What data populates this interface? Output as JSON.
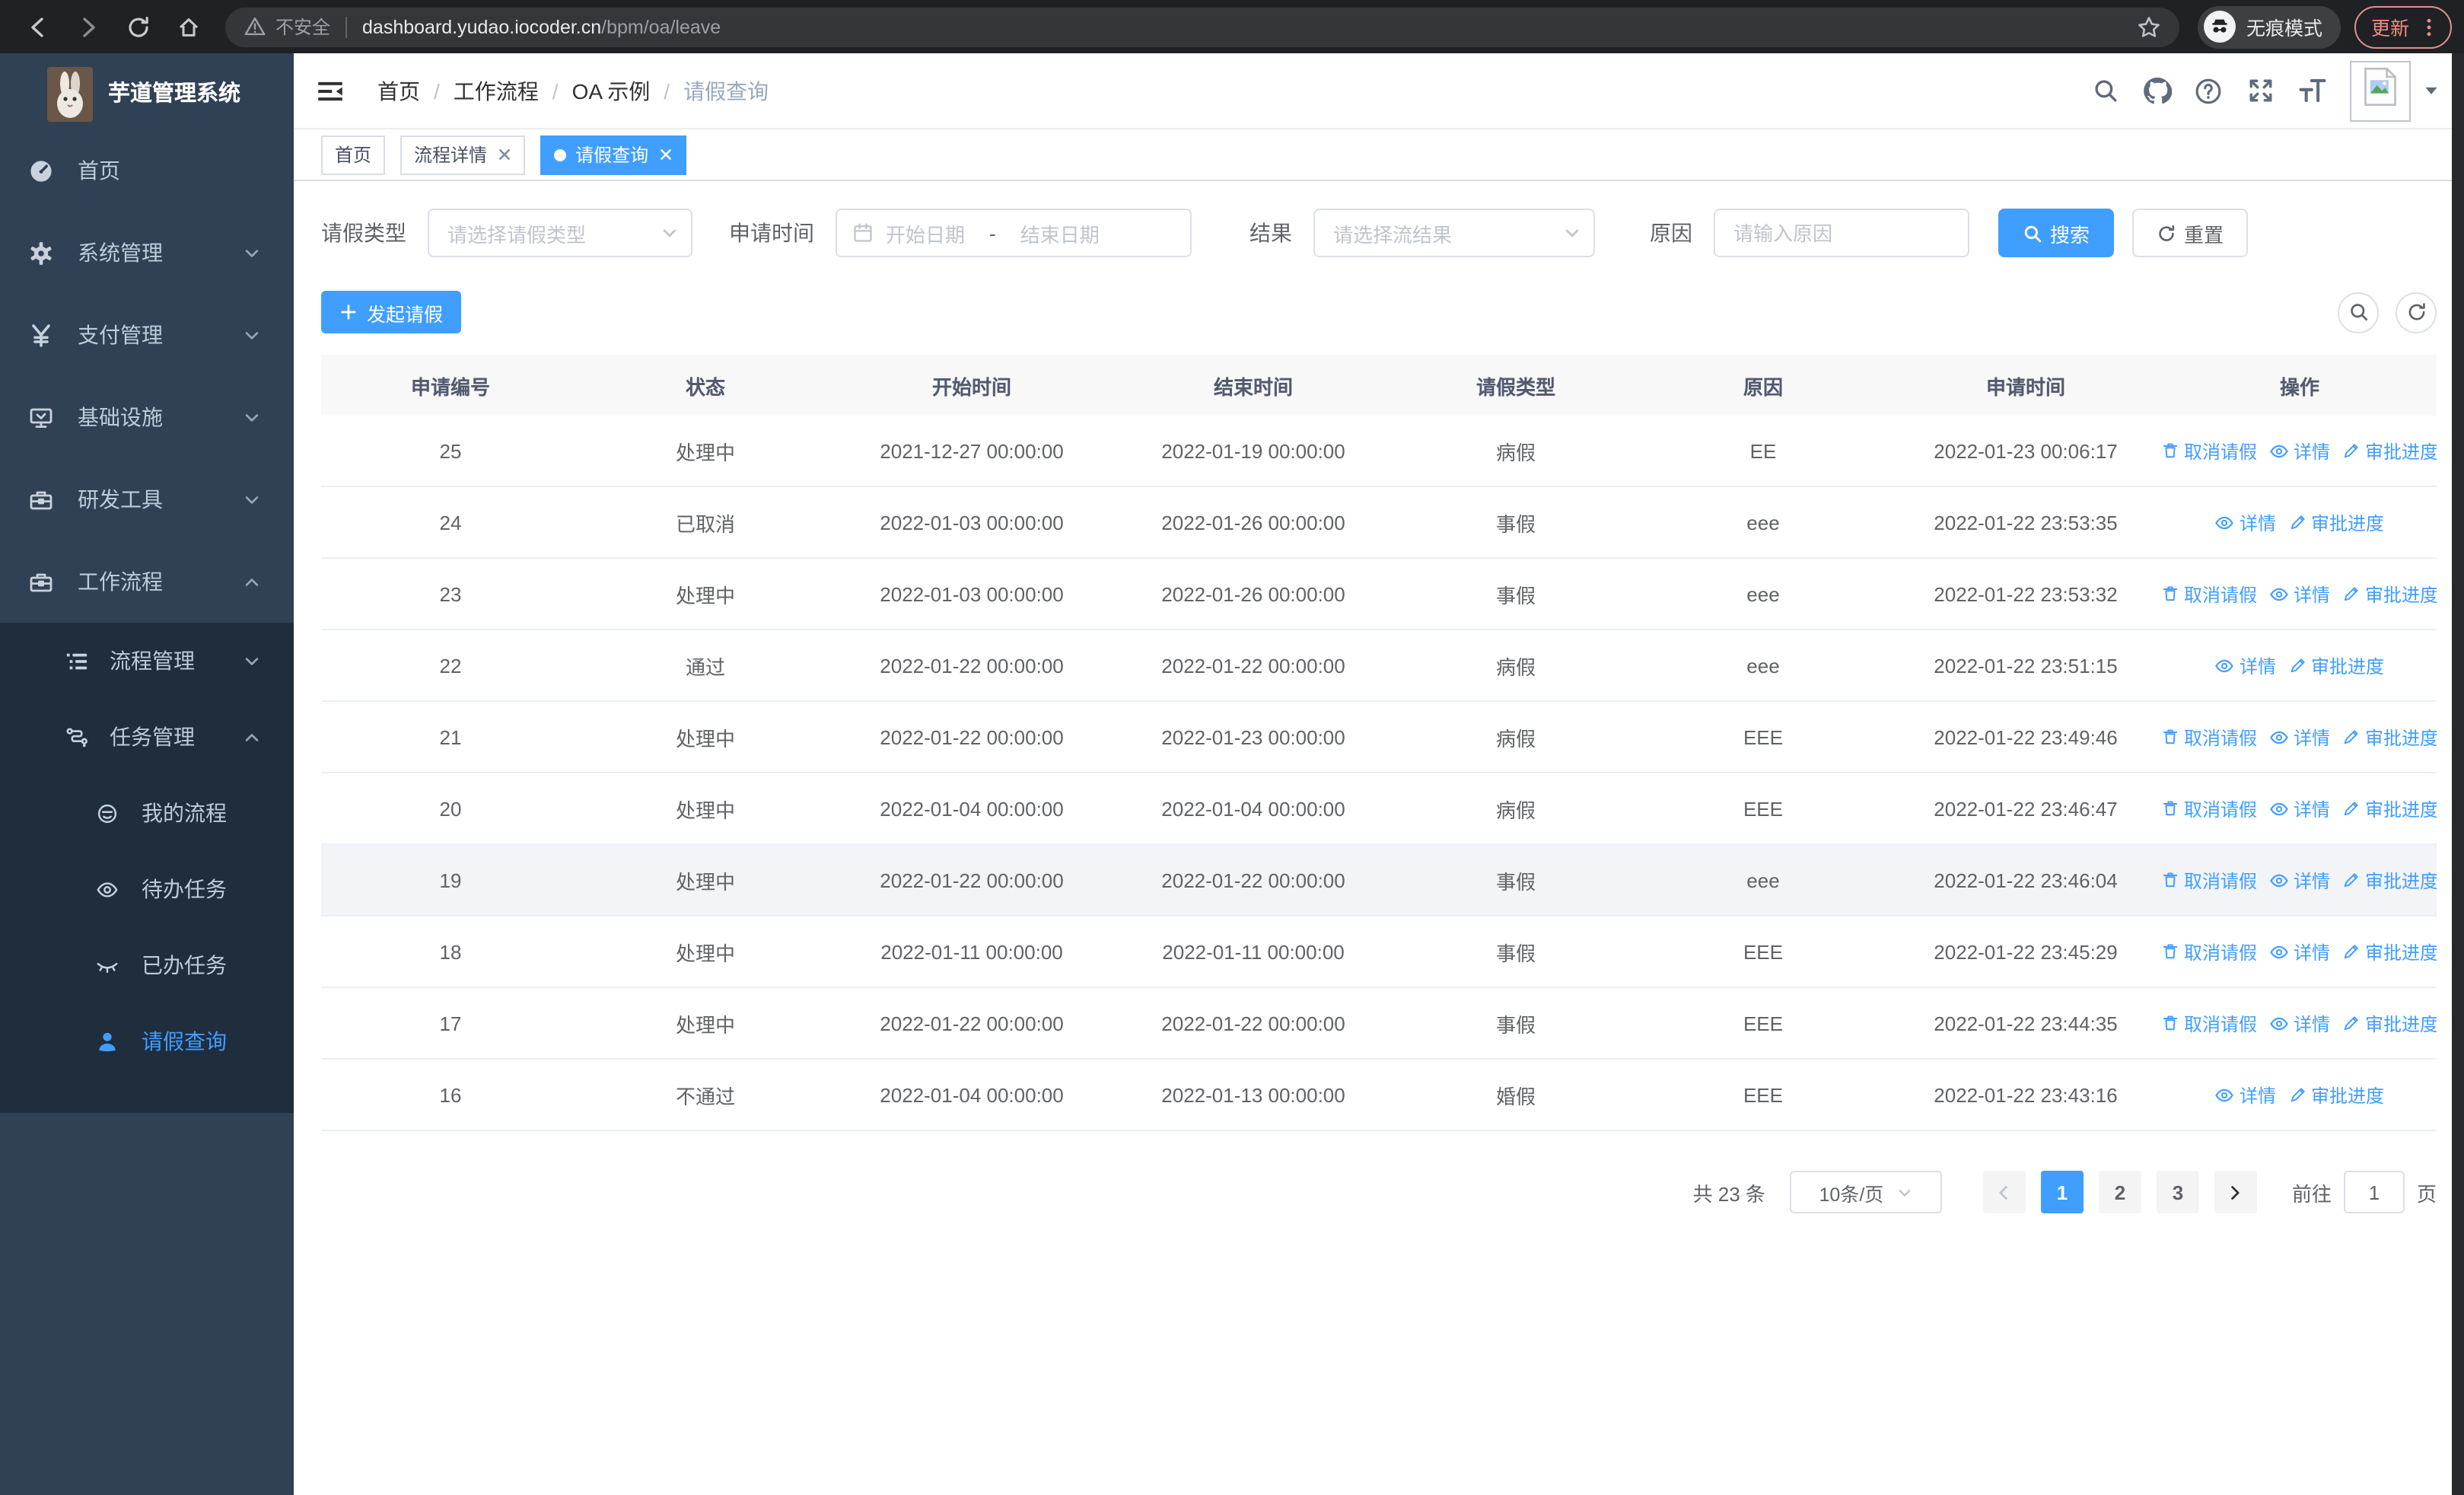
{
  "browser": {
    "security_label": "不安全",
    "url_host": "dashboard.yudao.iocoder.cn",
    "url_path": "/bpm/oa/leave",
    "incognito_label": "无痕模式",
    "update_label": "更新"
  },
  "sidebar": {
    "app_title": "芋道管理系统",
    "items": [
      {
        "label": "首页",
        "icon": "dashboard-icon"
      },
      {
        "label": "系统管理",
        "icon": "gear-icon",
        "state": "collapsed"
      },
      {
        "label": "支付管理",
        "icon": "yen-icon",
        "state": "collapsed"
      },
      {
        "label": "基础设施",
        "icon": "monitor-icon",
        "state": "collapsed"
      },
      {
        "label": "研发工具",
        "icon": "toolbox-icon",
        "state": "collapsed"
      },
      {
        "label": "工作流程",
        "icon": "briefcase-icon",
        "state": "expanded"
      }
    ],
    "workflow_children": {
      "process_mgmt": {
        "label": "流程管理",
        "icon": "list-tree-icon",
        "state": "collapsed"
      },
      "task_mgmt": {
        "label": "任务管理",
        "icon": "flow-icon",
        "state": "expanded"
      },
      "children": [
        {
          "label": "我的流程",
          "icon": "face-icon"
        },
        {
          "label": "待办任务",
          "icon": "eye-open-icon"
        },
        {
          "label": "已办任务",
          "icon": "eye-closed-icon"
        },
        {
          "label": "请假查询",
          "icon": "user-icon",
          "active": true
        }
      ]
    }
  },
  "header": {
    "breadcrumb": [
      "首页",
      "工作流程",
      "OA 示例",
      "请假查询"
    ],
    "separator": "/",
    "icons": [
      "search-icon",
      "github-icon",
      "help-icon",
      "fullscreen-icon",
      "font-size-icon",
      "avatar",
      "caret-down-icon"
    ]
  },
  "tabs": [
    {
      "label": "首页",
      "active": false,
      "closable": false
    },
    {
      "label": "流程详情",
      "active": false,
      "closable": true
    },
    {
      "label": "请假查询",
      "active": true,
      "closable": true
    }
  ],
  "filters": {
    "leave_type": {
      "label": "请假类型",
      "placeholder": "请选择请假类型"
    },
    "apply_time": {
      "label": "申请时间",
      "start_placeholder": "开始日期",
      "separator": "-",
      "end_placeholder": "结束日期"
    },
    "result": {
      "label": "结果",
      "placeholder": "请选择流结果"
    },
    "reason": {
      "label": "原因",
      "placeholder": "请输入原因"
    },
    "search_label": "搜索",
    "reset_label": "重置"
  },
  "toolbar": {
    "create_label": "发起请假"
  },
  "table": {
    "columns": [
      "申请编号",
      "状态",
      "开始时间",
      "结束时间",
      "请假类型",
      "原因",
      "申请时间",
      "操作"
    ],
    "action_labels": {
      "cancel": "取消请假",
      "detail": "详情",
      "progress": "审批进度"
    },
    "rows": [
      {
        "id": "25",
        "status": "处理中",
        "start": "2021-12-27 00:00:00",
        "end": "2022-01-19 00:00:00",
        "type": "病假",
        "reason": "EE",
        "applied": "2022-01-23 00:06:17",
        "actions": [
          "cancel",
          "detail",
          "progress"
        ],
        "highlight": false
      },
      {
        "id": "24",
        "status": "已取消",
        "start": "2022-01-03 00:00:00",
        "end": "2022-01-26 00:00:00",
        "type": "事假",
        "reason": "eee",
        "applied": "2022-01-22 23:53:35",
        "actions": [
          "detail",
          "progress"
        ],
        "highlight": false
      },
      {
        "id": "23",
        "status": "处理中",
        "start": "2022-01-03 00:00:00",
        "end": "2022-01-26 00:00:00",
        "type": "事假",
        "reason": "eee",
        "applied": "2022-01-22 23:53:32",
        "actions": [
          "cancel",
          "detail",
          "progress"
        ],
        "highlight": false
      },
      {
        "id": "22",
        "status": "通过",
        "start": "2022-01-22 00:00:00",
        "end": "2022-01-22 00:00:00",
        "type": "病假",
        "reason": "eee",
        "applied": "2022-01-22 23:51:15",
        "actions": [
          "detail",
          "progress"
        ],
        "highlight": false
      },
      {
        "id": "21",
        "status": "处理中",
        "start": "2022-01-22 00:00:00",
        "end": "2022-01-23 00:00:00",
        "type": "病假",
        "reason": "EEE",
        "applied": "2022-01-22 23:49:46",
        "actions": [
          "cancel",
          "detail",
          "progress"
        ],
        "highlight": false
      },
      {
        "id": "20",
        "status": "处理中",
        "start": "2022-01-04 00:00:00",
        "end": "2022-01-04 00:00:00",
        "type": "病假",
        "reason": "EEE",
        "applied": "2022-01-22 23:46:47",
        "actions": [
          "cancel",
          "detail",
          "progress"
        ],
        "highlight": false
      },
      {
        "id": "19",
        "status": "处理中",
        "start": "2022-01-22 00:00:00",
        "end": "2022-01-22 00:00:00",
        "type": "事假",
        "reason": "eee",
        "applied": "2022-01-22 23:46:04",
        "actions": [
          "cancel",
          "detail",
          "progress"
        ],
        "highlight": true
      },
      {
        "id": "18",
        "status": "处理中",
        "start": "2022-01-11 00:00:00",
        "end": "2022-01-11 00:00:00",
        "type": "事假",
        "reason": "EEE",
        "applied": "2022-01-22 23:45:29",
        "actions": [
          "cancel",
          "detail",
          "progress"
        ],
        "highlight": false
      },
      {
        "id": "17",
        "status": "处理中",
        "start": "2022-01-22 00:00:00",
        "end": "2022-01-22 00:00:00",
        "type": "事假",
        "reason": "EEE",
        "applied": "2022-01-22 23:44:35",
        "actions": [
          "cancel",
          "detail",
          "progress"
        ],
        "highlight": false
      },
      {
        "id": "16",
        "status": "不通过",
        "start": "2022-01-04 00:00:00",
        "end": "2022-01-13 00:00:00",
        "type": "婚假",
        "reason": "EEE",
        "applied": "2022-01-22 23:43:16",
        "actions": [
          "detail",
          "progress"
        ],
        "highlight": false
      }
    ]
  },
  "pagination": {
    "total_label": "共 23 条",
    "page_size": "10条/页",
    "pages": [
      "1",
      "2",
      "3"
    ],
    "current_page": "1",
    "goto_label": "前往",
    "goto_value": "1",
    "page_unit": "页"
  },
  "colors": {
    "accent": "#409eff",
    "sidebar_bg": "#304156",
    "submenu_bg": "#1f2d3d",
    "tag_active": "#409eff"
  }
}
